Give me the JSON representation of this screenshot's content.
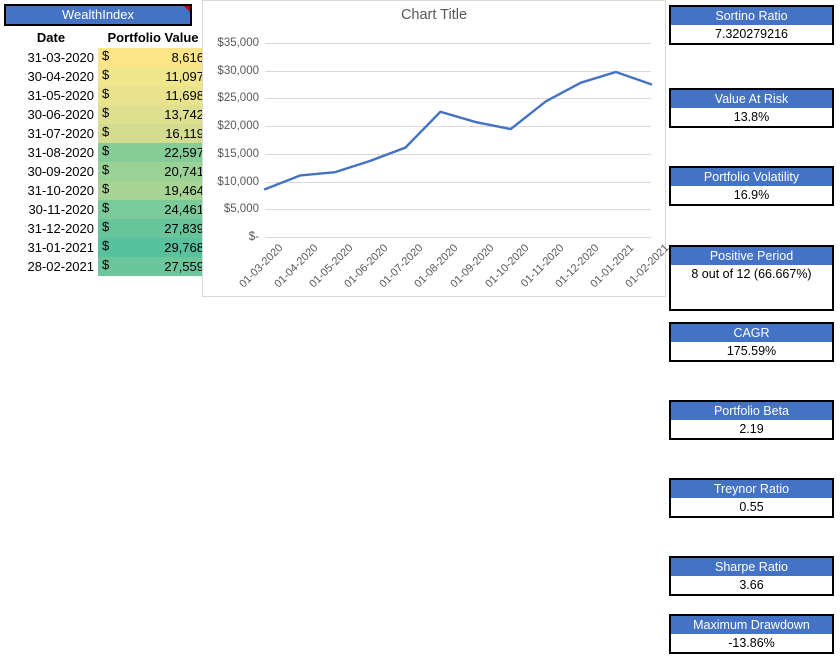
{
  "wealth_table": {
    "title": "WealthIndex",
    "comment_flag_icon": "comment-indicator-icon",
    "columns": [
      "Date",
      "Portfolio Value"
    ],
    "currency_symbol": "$",
    "rows": [
      {
        "date": "31-03-2020",
        "value": "8,616",
        "fill": "#FCE487"
      },
      {
        "date": "30-04-2020",
        "value": "11,097",
        "fill": "#F0E68B"
      },
      {
        "date": "31-05-2020",
        "value": "11,698",
        "fill": "#EAE38D"
      },
      {
        "date": "30-06-2020",
        "value": "13,742",
        "fill": "#DFE08F"
      },
      {
        "date": "31-07-2020",
        "value": "16,119",
        "fill": "#D3DC91"
      },
      {
        "date": "31-08-2020",
        "value": "22,597",
        "fill": "#86CC97"
      },
      {
        "date": "30-09-2020",
        "value": "20,741",
        "fill": "#9AD195"
      },
      {
        "date": "31-10-2020",
        "value": "19,464",
        "fill": "#A7D494"
      },
      {
        "date": "30-11-2020",
        "value": "24,461",
        "fill": "#7BCA99"
      },
      {
        "date": "31-12-2020",
        "value": "27,839",
        "fill": "#68C59B"
      },
      {
        "date": "31-01-2021",
        "value": "29,768",
        "fill": "#57C29D"
      },
      {
        "date": "28-02-2021",
        "value": "27,559",
        "fill": "#6BC69B"
      }
    ]
  },
  "chart_data": {
    "type": "line",
    "title": "Chart Title",
    "xlabel": "",
    "ylabel": "",
    "legend": false,
    "grid": true,
    "line_color": "#4472C4",
    "categories": [
      "01-03-2020",
      "01-04-2020",
      "01-05-2020",
      "01-06-2020",
      "01-07-2020",
      "01-08-2020",
      "01-09-2020",
      "01-10-2020",
      "01-11-2020",
      "01-12-2020",
      "01-01-2021",
      "01-02-2021"
    ],
    "values": [
      8616,
      11097,
      11698,
      13742,
      16119,
      22597,
      20741,
      19464,
      24461,
      27839,
      29768,
      27559
    ],
    "ylim": [
      0,
      35000
    ],
    "ytick_labels": [
      "$35,000",
      "$30,000",
      "$25,000",
      "$20,000",
      "$15,000",
      "$10,000",
      "$5,000",
      "$-"
    ],
    "ytick_values": [
      35000,
      30000,
      25000,
      20000,
      15000,
      10000,
      5000,
      0
    ]
  },
  "metrics": [
    {
      "label": "Sortino Ratio",
      "value": "7.320279216",
      "tall": false
    },
    {
      "label": "Value At Risk",
      "value": "13.8%",
      "tall": false
    },
    {
      "label": "Portfolio Volatility",
      "value": "16.9%",
      "tall": false
    },
    {
      "label": "Positive Period",
      "value": "8 out of 12 (66.667%)",
      "tall": true
    },
    {
      "label": "CAGR",
      "value": "175.59%",
      "tall": false
    },
    {
      "label": "Portfolio Beta",
      "value": "2.19",
      "tall": false
    },
    {
      "label": "Treynor Ratio",
      "value": "0.55",
      "tall": false
    },
    {
      "label": "Sharpe Ratio",
      "value": "3.66",
      "tall": false
    },
    {
      "label": "Maximum Drawdown",
      "value": "-13.86%",
      "tall": false
    }
  ],
  "metric_layout": {
    "tops": [
      5,
      88,
      166,
      245,
      322,
      400,
      478,
      556,
      614
    ],
    "body_heights": [
      18,
      18,
      18,
      44,
      18,
      18,
      18,
      18,
      18
    ]
  },
  "colors": {
    "accent": "#4472C4",
    "header_text": "#FFFFFF",
    "grid": "#D9D9D9",
    "axis_text": "#595959"
  }
}
